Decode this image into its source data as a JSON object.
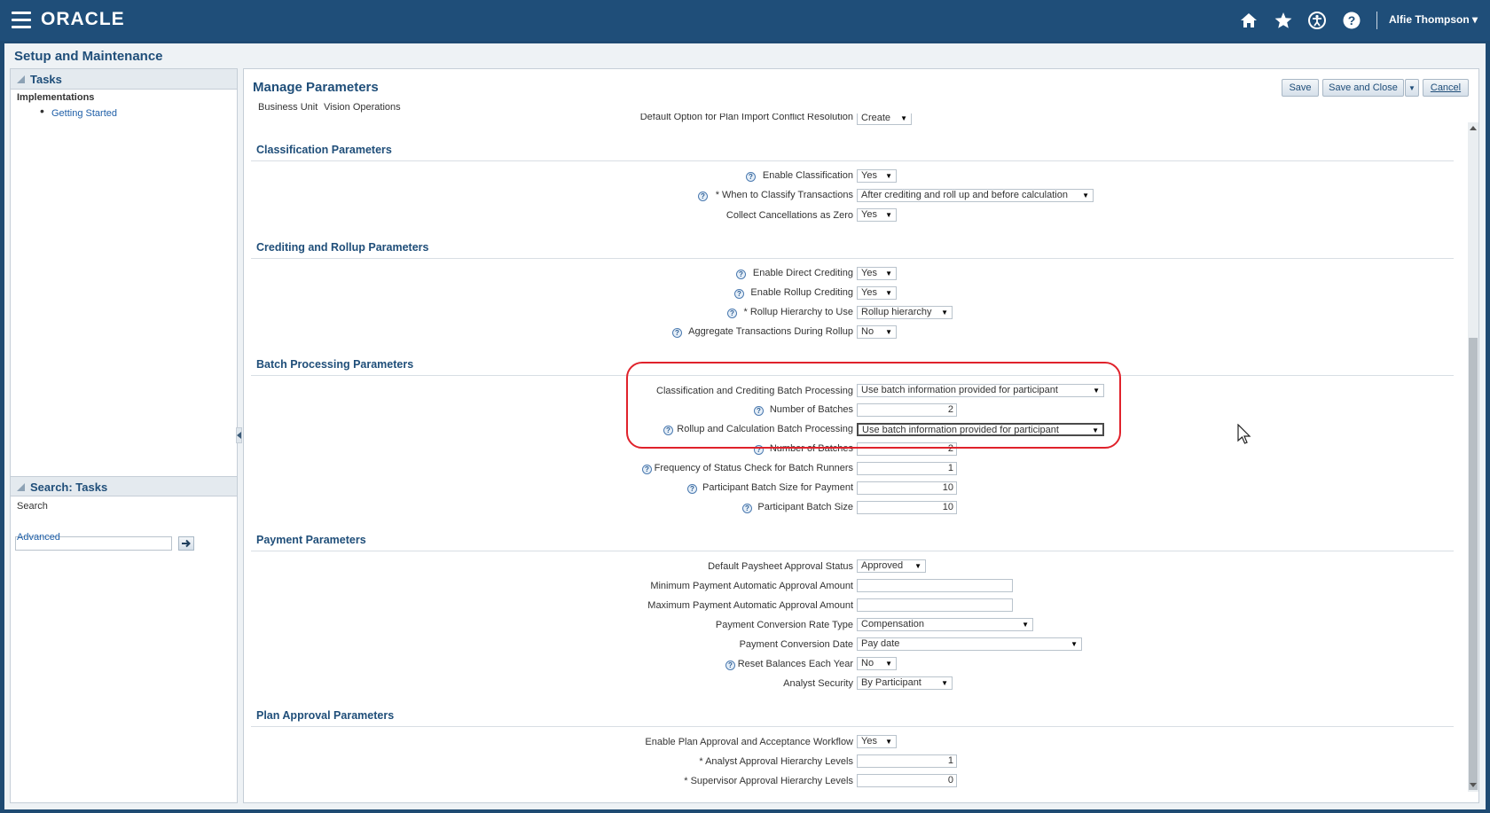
{
  "header": {
    "logo": "ORACLE",
    "user": "Alfie Thompson",
    "user_caret": "▾",
    "icons": [
      "home-icon",
      "favorites-star-icon",
      "accessibility-icon",
      "help-icon"
    ]
  },
  "page_title": "Setup and Maintenance",
  "tasks": {
    "title": "Tasks",
    "group": "Implementations",
    "items": [
      "Getting Started"
    ]
  },
  "search_tasks": {
    "title": "Search: Tasks",
    "search_label": "Search",
    "search_value": "",
    "advanced": "Advanced"
  },
  "main": {
    "title": "Manage Parameters",
    "business_unit_label": "Business Unit",
    "business_unit_value": "Vision Operations",
    "buttons": {
      "save": "Save",
      "save_close": "Save and Close",
      "cancel": "Cancel"
    },
    "cut_row": {
      "label": "Default Option for Plan Import Conflict Resolution",
      "value": "Create"
    },
    "sections": {
      "classification": {
        "title": "Classification Parameters",
        "rows": [
          {
            "label": "Enable Classification",
            "value": "Yes",
            "help": true
          },
          {
            "label": "* When to Classify Transactions",
            "value": "After crediting and roll up and before calculation",
            "help": true
          },
          {
            "label": "Collect Cancellations as Zero",
            "value": "Yes",
            "help": false
          }
        ]
      },
      "crediting": {
        "title": "Crediting and Rollup Parameters",
        "rows": [
          {
            "label": "Enable Direct Crediting",
            "value": "Yes",
            "help": true
          },
          {
            "label": "Enable Rollup Crediting",
            "value": "Yes",
            "help": true
          },
          {
            "label": "* Rollup Hierarchy to Use",
            "value": "Rollup hierarchy",
            "help": true
          },
          {
            "label": "Aggregate Transactions During Rollup",
            "value": "No",
            "help": true
          }
        ]
      },
      "batch": {
        "title": "Batch Processing Parameters",
        "rows": [
          {
            "label": "Classification and Crediting Batch Processing",
            "value": "Use batch information provided for participant",
            "help": false
          },
          {
            "label": "Number of Batches",
            "value": "2",
            "help": true
          },
          {
            "label": "Rollup and Calculation Batch Processing",
            "value": "Use batch information provided for participant",
            "help": true
          },
          {
            "label": "Number of Batches",
            "value": "2",
            "help": true
          },
          {
            "label": "Frequency of Status Check for Batch Runners",
            "value": "1",
            "help": true
          },
          {
            "label": "Participant Batch Size for Payment",
            "value": "10",
            "help": true
          },
          {
            "label": "Participant Batch Size",
            "value": "10",
            "help": true
          }
        ]
      },
      "payment": {
        "title": "Payment Parameters",
        "rows": [
          {
            "label": "Default Paysheet Approval Status",
            "value": "Approved",
            "help": false
          },
          {
            "label": "Minimum Payment Automatic Approval Amount",
            "value": "",
            "help": false
          },
          {
            "label": "Maximum Payment Automatic Approval Amount",
            "value": "",
            "help": false
          },
          {
            "label": "Payment Conversion Rate Type",
            "value": "Compensation",
            "help": false
          },
          {
            "label": "Payment Conversion Date",
            "value": "Pay date",
            "help": false
          },
          {
            "label": "Reset Balances Each Year",
            "value": "No",
            "help": true
          },
          {
            "label": "Analyst Security",
            "value": "By Participant",
            "help": false
          }
        ]
      },
      "plan_approval": {
        "title": "Plan Approval Parameters",
        "rows": [
          {
            "label": "Enable Plan Approval and Acceptance Workflow",
            "value": "Yes",
            "help": false
          },
          {
            "label": "* Analyst Approval Hierarchy Levels",
            "value": "1",
            "help": false
          },
          {
            "label": "* Supervisor Approval Hierarchy Levels",
            "value": "0",
            "help": false
          }
        ]
      }
    }
  },
  "colors": {
    "header": "#1f4e79",
    "highlight": "#e0222b"
  }
}
